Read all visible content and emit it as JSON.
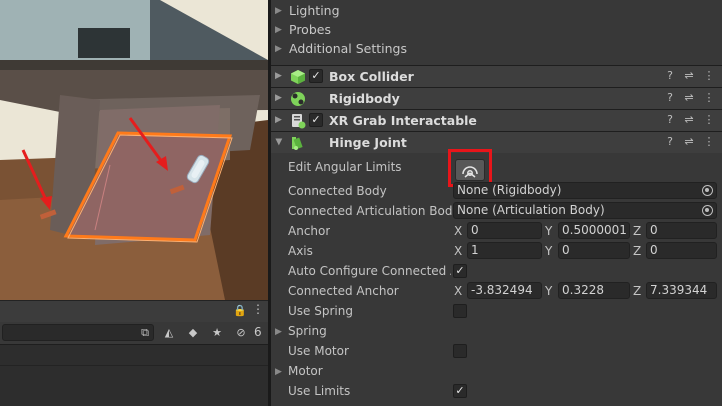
{
  "scene": {
    "hidden_count": "6",
    "colors": {
      "highlight": "#ff7a1a",
      "arrow": "#e51d1d"
    }
  },
  "inspector": {
    "sections": [
      {
        "label": "Lighting"
      },
      {
        "label": "Probes"
      },
      {
        "label": "Additional Settings"
      }
    ],
    "components": [
      {
        "title": "Box Collider",
        "icon": "box-collider-icon",
        "checked": true
      },
      {
        "title": "Rigidbody",
        "icon": "rigidbody-icon",
        "checked": false
      },
      {
        "title": "XR Grab Interactable",
        "icon": "xr-grab-icon",
        "checked": true
      },
      {
        "title": "Hinge Joint",
        "icon": "hinge-joint-icon",
        "checked": false
      }
    ],
    "hinge": {
      "edit_angular_limits": "Edit Angular Limits",
      "connected_body": {
        "label": "Connected Body",
        "value": "None (Rigidbody)"
      },
      "connected_articulation_body": {
        "label": "Connected Articulation Body",
        "value": "None (Articulation Body)"
      },
      "anchor": {
        "label": "Anchor",
        "x": "0",
        "y": "0.5000001",
        "z": "0"
      },
      "axis": {
        "label": "Axis",
        "x": "1",
        "y": "0",
        "z": "0"
      },
      "auto_configure": {
        "label": "Auto Configure Connected Ar",
        "checked": true
      },
      "connected_anchor": {
        "label": "Connected Anchor",
        "x": "-3.832494",
        "y": "0.3228",
        "z": "7.339344"
      },
      "use_spring": {
        "label": "Use Spring",
        "checked": false
      },
      "spring": {
        "label": "Spring"
      },
      "use_motor": {
        "label": "Use Motor",
        "checked": false
      },
      "motor": {
        "label": "Motor"
      },
      "use_limits": {
        "label": "Use Limits",
        "checked": true
      }
    },
    "axis_letters": {
      "x": "X",
      "y": "Y",
      "z": "Z"
    },
    "check_glyph": "✓",
    "colors": {
      "annotation_box": "#e8151a"
    }
  }
}
